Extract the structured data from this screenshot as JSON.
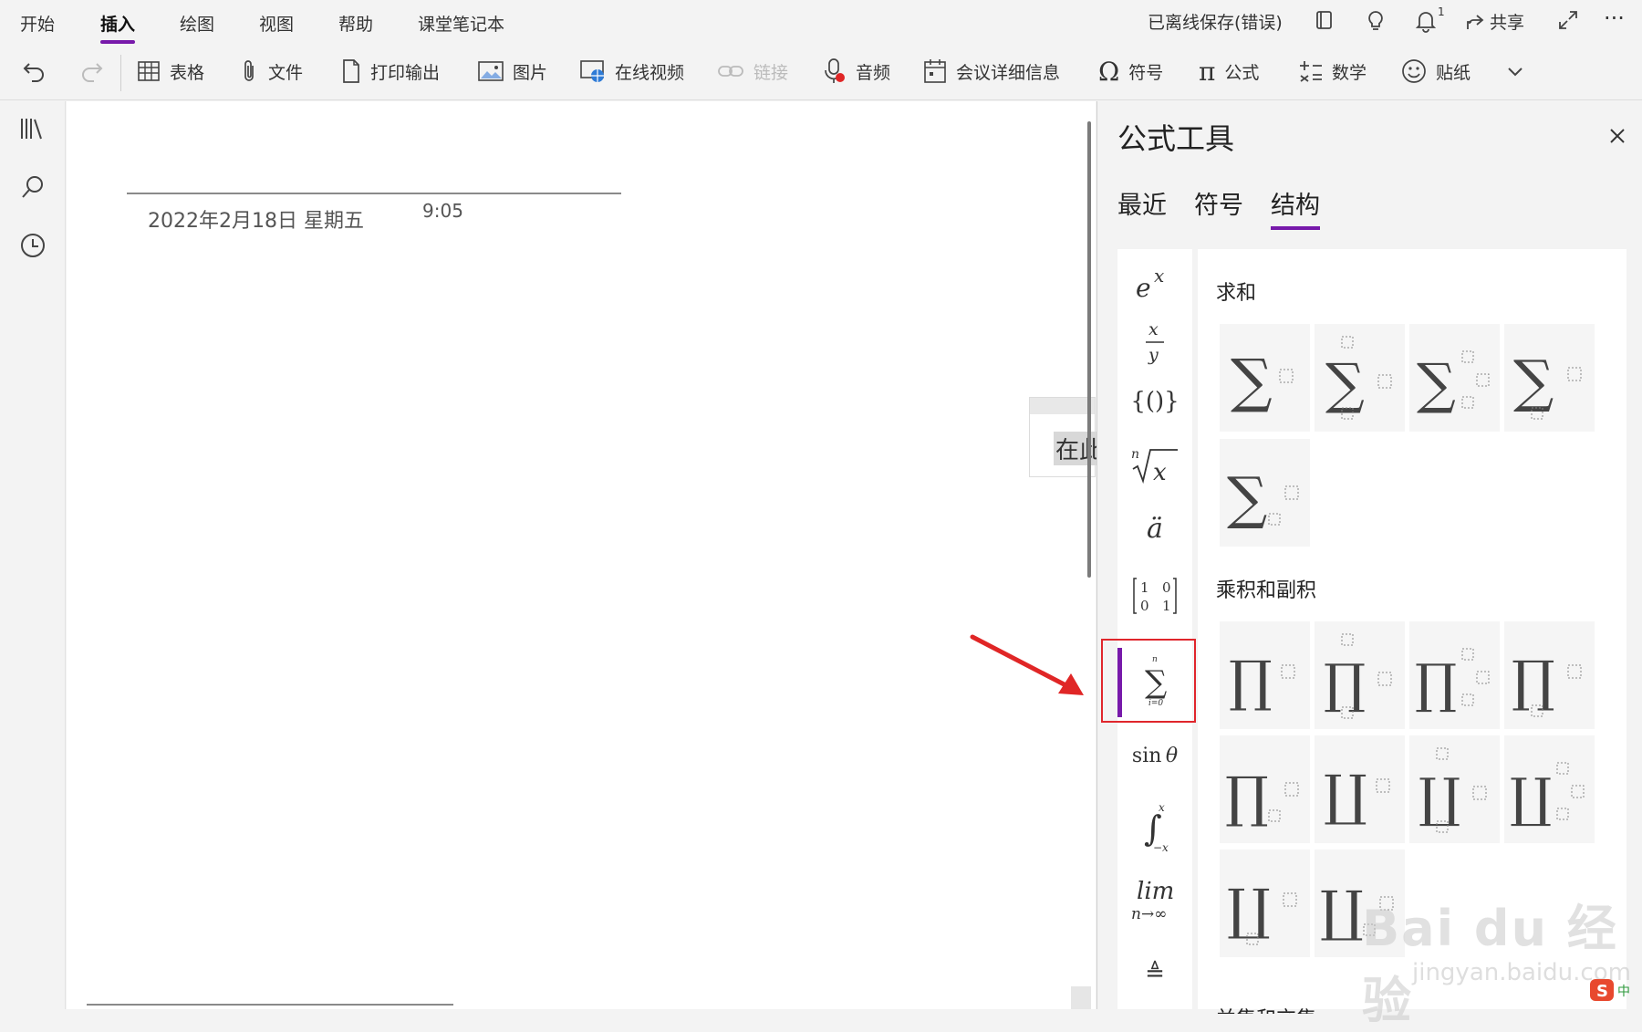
{
  "ribbon": {
    "tabs": [
      "开始",
      "插入",
      "绘图",
      "视图",
      "帮助",
      "课堂笔记本"
    ],
    "active_tab": "插入",
    "status": "已离线保存(错误)",
    "share_label": "共享",
    "notification_count": "1",
    "commands": {
      "table": "表格",
      "file": "文件",
      "print": "打印输出",
      "picture": "图片",
      "video": "在线视频",
      "link": "链接",
      "audio": "音频",
      "meeting": "会议详细信息",
      "symbol": "符号",
      "equation": "公式",
      "math": "数学",
      "sticker": "贴纸"
    }
  },
  "page": {
    "date": "2022年2月18日 星期五",
    "time": "9:05",
    "note_text": "在此"
  },
  "pane": {
    "title": "公式工具",
    "tabs": [
      "最近",
      "符号",
      "结构"
    ],
    "active_tab": "结构",
    "sections": {
      "summation": "求和",
      "products": "乘积和副积",
      "partial": "并集和交集"
    },
    "categories": [
      "script",
      "fraction",
      "bracket",
      "radical",
      "accent",
      "matrix",
      "large-operator",
      "function",
      "integral",
      "limit",
      "operator"
    ]
  },
  "watermark": {
    "main": "Bai du 经验",
    "url": "jingyan.baidu.com"
  },
  "colors": {
    "accent": "#7719aa",
    "highlight_red": "#e0262c",
    "arrow_red": "#e02626"
  }
}
